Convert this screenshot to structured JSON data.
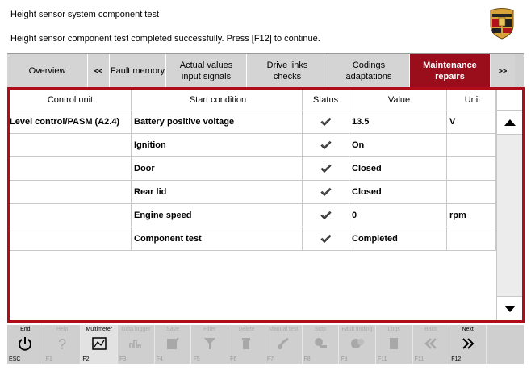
{
  "header": {
    "title": "Height sensor system component test",
    "message": "Height sensor component test completed successfully. Press [F12] to continue."
  },
  "tabs": [
    {
      "label": "Overview",
      "active": false
    },
    {
      "label": "<<",
      "active": false
    },
    {
      "label": "Fault memory",
      "active": false
    },
    {
      "label": "Actual values\ninput signals",
      "active": false
    },
    {
      "label": "Drive links\nchecks",
      "active": false
    },
    {
      "label": "Codings\nadaptations",
      "active": false
    },
    {
      "label": "Maintenance\nrepairs",
      "active": true
    },
    {
      "label": ">>",
      "active": false
    }
  ],
  "table": {
    "headers": [
      "Control unit",
      "Start condition",
      "Status",
      "Value",
      "Unit"
    ],
    "rows": [
      {
        "control_unit": "Level control/PASM (A2.4)",
        "condition": "Battery positive voltage",
        "status": "ok",
        "value": "13.5",
        "unit": "V"
      },
      {
        "control_unit": "",
        "condition": "Ignition",
        "status": "ok",
        "value": "On",
        "unit": ""
      },
      {
        "control_unit": "",
        "condition": "Door",
        "status": "ok",
        "value": "Closed",
        "unit": ""
      },
      {
        "control_unit": "",
        "condition": "Rear lid",
        "status": "ok",
        "value": "Closed",
        "unit": ""
      },
      {
        "control_unit": "",
        "condition": "Engine speed",
        "status": "ok",
        "value": "0",
        "unit": "rpm"
      },
      {
        "control_unit": "",
        "condition": "Component test",
        "status": "ok",
        "value": "Completed",
        "unit": ""
      }
    ]
  },
  "toolbar": [
    {
      "label": "End",
      "key": "ESC",
      "icon": "power-icon",
      "enabled": true
    },
    {
      "label": "Help",
      "key": "F1",
      "icon": "question-icon",
      "enabled": false
    },
    {
      "label": "Multimeter",
      "key": "F2",
      "icon": "multimeter-icon",
      "enabled": true,
      "active": true
    },
    {
      "label": "Data logger",
      "key": "F3",
      "icon": "data-logger-icon",
      "enabled": false
    },
    {
      "label": "Save",
      "key": "F4",
      "icon": "save-icon",
      "enabled": false
    },
    {
      "label": "Filter",
      "key": "F5",
      "icon": "filter-icon",
      "enabled": false
    },
    {
      "label": "Delete",
      "key": "F6",
      "icon": "delete-icon",
      "enabled": false
    },
    {
      "label": "Manual test",
      "key": "F7",
      "icon": "manual-test-icon",
      "enabled": false
    },
    {
      "label": "Stop",
      "key": "F8",
      "icon": "stop-icon",
      "enabled": false
    },
    {
      "label": "Fault finding",
      "key": "F9",
      "icon": "fault-finding-icon",
      "enabled": false
    },
    {
      "label": "Logs",
      "key": "F11",
      "icon": "logs-icon",
      "enabled": false
    },
    {
      "label": "Back",
      "key": "F11",
      "icon": "back-icon",
      "enabled": false
    },
    {
      "label": "Next",
      "key": "F12",
      "icon": "next-icon",
      "enabled": true
    }
  ],
  "colors": {
    "accent": "#9a0d1a",
    "border": "#b00c1a",
    "toolbar": "#cfcfcf"
  }
}
